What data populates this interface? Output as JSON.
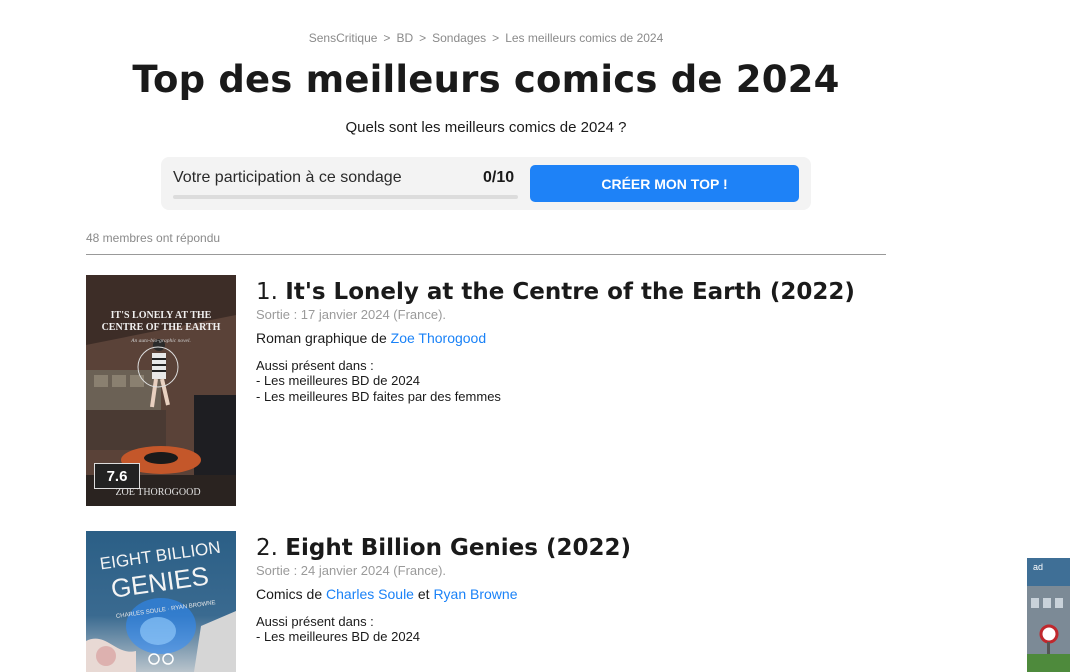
{
  "breadcrumb": [
    "SensCritique",
    "BD",
    "Sondages",
    "Les meilleurs comics de 2024"
  ],
  "title": "Top des meilleurs comics de 2024",
  "subtitle": "Quels sont les meilleurs comics de 2024 ?",
  "participation": {
    "label": "Votre participation à ce sondage",
    "count": "0/10",
    "progress": 0,
    "button": "CRÉER MON TOP !"
  },
  "respondents": "48 membres ont répondu",
  "items": [
    {
      "rank": "1.",
      "title": "It's Lonely at the Centre of the Earth (2022)",
      "release": "Sortie : 17 janvier 2024 (France).",
      "type": "Roman graphique de",
      "authors": [
        "Zoe Thorogood"
      ],
      "also_title": "Aussi présent dans :",
      "also": [
        "- Les meilleures BD de 2024",
        "- Les meilleures BD faites par des femmes"
      ],
      "score": "7.6",
      "cover_title": [
        "IT'S LONELY AT THE",
        "CENTRE OF THE EARTH"
      ],
      "cover_sub": "An auto-bio-graphic novel.",
      "cover_author": "ZOE THOROGOOD"
    },
    {
      "rank": "2.",
      "title": "Eight Billion Genies (2022)",
      "release": "Sortie : 24 janvier 2024 (France).",
      "type": "Comics de",
      "authors": [
        "Charles Soule",
        "Ryan Browne"
      ],
      "author_join": "et",
      "also_title": "Aussi présent dans :",
      "also": [
        "- Les meilleures BD de 2024"
      ],
      "cover_title": [
        "EIGHT BILLION",
        "GENIES"
      ],
      "cover_author": "CHARLES SOULE · RYAN BROWNE"
    }
  ],
  "ad": {
    "label": "ad"
  },
  "colors": {
    "accent": "#1e82f7",
    "text": "#1a1a1a",
    "muted": "#8a8a8a"
  }
}
